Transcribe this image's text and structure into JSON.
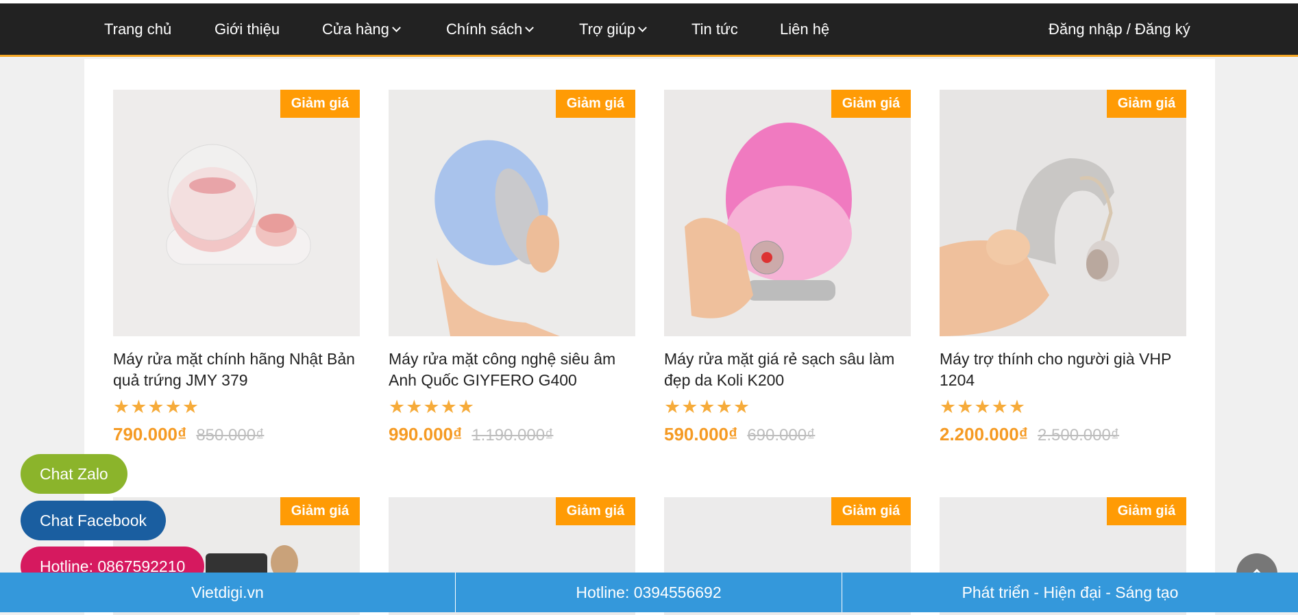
{
  "nav": {
    "items": [
      {
        "label": "Trang chủ",
        "dropdown": false
      },
      {
        "label": "Giới thiệu",
        "dropdown": false
      },
      {
        "label": "Cửa hàng",
        "dropdown": true
      },
      {
        "label": "Chính sách",
        "dropdown": true
      },
      {
        "label": "Trợ giúp",
        "dropdown": true
      },
      {
        "label": "Tin tức",
        "dropdown": false
      },
      {
        "label": "Liên hệ",
        "dropdown": false
      }
    ],
    "login": "Đăng nhập / Đăng ký"
  },
  "badge_label": "Giảm giá",
  "products": [
    {
      "name": "Máy rửa mặt chính hãng Nhật Bản quả trứng JMY 379",
      "rating": 5,
      "price": "790.000₫",
      "old_price": "850.000₫"
    },
    {
      "name": "Máy rửa mặt công nghệ siêu âm Anh Quốc GIYFERO G400",
      "rating": 5,
      "price": "990.000₫",
      "old_price": "1.190.000₫"
    },
    {
      "name": "Máy rửa mặt giá rẻ sạch sâu làm đẹp da Koli K200",
      "rating": 5,
      "price": "590.000₫",
      "old_price": "690.000₫"
    },
    {
      "name": "Máy trợ thính cho người già VHP 1204",
      "rating": 5,
      "price": "2.200.000₫",
      "old_price": "2.500.000₫"
    }
  ],
  "chat": {
    "zalo": "Chat Zalo",
    "facebook": "Chat Facebook",
    "hotline": "Hotline: 0867592210"
  },
  "footer": {
    "site": "Vietdigi.vn",
    "hotline": "Hotline: 0394556692",
    "slogan": "Phát triển - Hiện đại - Sáng tạo"
  },
  "colors": {
    "nav_bg": "#222222",
    "accent": "#f5a623",
    "badge": "#ff9b05",
    "footer": "#3498db",
    "zalo": "#8bb42b",
    "facebook": "#1a5ea0",
    "hotline": "#d6195f"
  }
}
